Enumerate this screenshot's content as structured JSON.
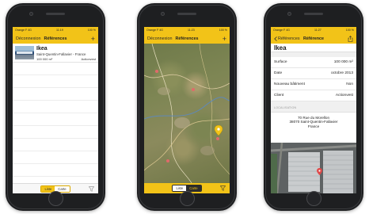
{
  "screen1": {
    "status": {
      "carrier": "Orange F",
      "network": "4G",
      "time": "11:19",
      "battery": "100 %"
    },
    "nav": {
      "left": "Déconnexion",
      "title": "Références",
      "right": "+"
    },
    "items": [
      {
        "title": "Ikea",
        "location": "Saint-Quentin-Fallavier - France",
        "surface": "100 000 m²",
        "client": "Actionvest"
      }
    ],
    "bottom": {
      "tab_list": "Liste",
      "tab_map": "Carte",
      "filter_icon": "filter-icon"
    }
  },
  "screen2": {
    "status": {
      "carrier": "Orange F",
      "network": "4G",
      "time": "11:23",
      "battery": "100 %"
    },
    "nav": {
      "left": "Déconnexion",
      "title": "Références",
      "right": "+"
    },
    "map": {
      "pin_icon": "map-pin-icon"
    },
    "bottom": {
      "tab_list": "Liste",
      "tab_map": "Carte",
      "filter_icon": "filter-icon"
    }
  },
  "screen3": {
    "status": {
      "carrier": "Orange F",
      "network": "4G",
      "time": "11:27",
      "battery": "100 %"
    },
    "nav": {
      "back": "Références",
      "title": "Référence",
      "share_icon": "share-icon"
    },
    "title": "Ikea",
    "fields": [
      {
        "label": "Surface",
        "value": "100 000 m²"
      },
      {
        "label": "Date",
        "value": "octobre 2013"
      },
      {
        "label": "Nouveau bâtiment",
        "value": "Non"
      },
      {
        "label": "Client",
        "value": "Actionvest"
      }
    ],
    "section": "LOCALISATION",
    "address": {
      "line1": "70 Rue du Morellon",
      "line2": "38070 Saint-Quentin-Fallavier",
      "line3": "France"
    }
  },
  "colors": {
    "accent": "#f2c318",
    "bar_light": "#f7f7f7"
  }
}
